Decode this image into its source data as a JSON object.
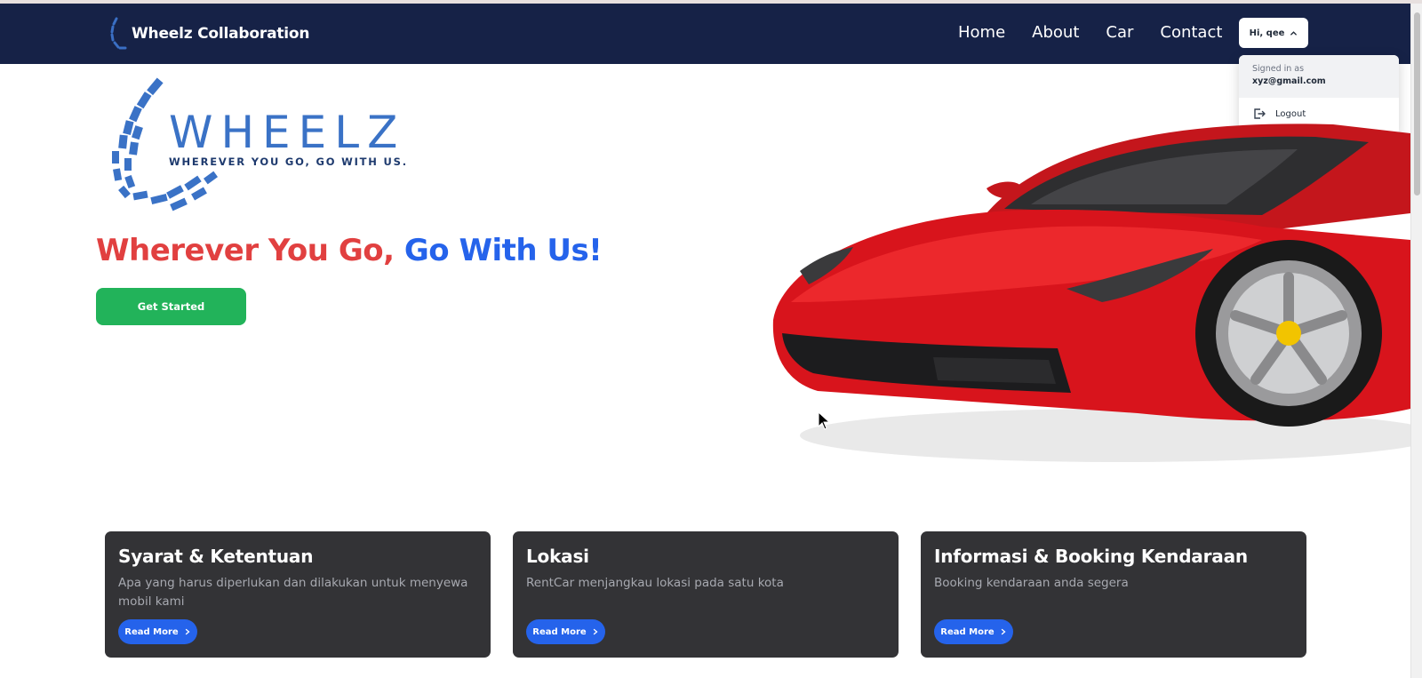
{
  "navbar": {
    "brand": "Wheelz Collaboration",
    "links": [
      "Home",
      "About",
      "Car",
      "Contact"
    ],
    "user_button": "Hi, qee"
  },
  "user_menu": {
    "signed_in_label": "Signed in as",
    "email": "xyz@gmail.com",
    "logout": "Logout"
  },
  "hero": {
    "logo_word": "WHEELZ",
    "logo_tagline": "WHEREVER YOU GO, GO WITH US.",
    "title_part1": "Wherever You Go,",
    "title_part2": "Go With Us!",
    "cta": "Get Started"
  },
  "cards": [
    {
      "title": "Syarat & Ketentuan",
      "text": "Apa yang harus diperlukan dan dilakukan untuk menyewa mobil kami",
      "button": "Read More"
    },
    {
      "title": "Lokasi",
      "text": "RentCar menjangkau lokasi pada satu kota",
      "button": "Read More"
    },
    {
      "title": "Informasi & Booking Kendaraan",
      "text": "Booking kendaraan anda segera",
      "button": "Read More"
    }
  ],
  "colors": {
    "navbar_bg": "#162247",
    "accent_blue": "#2563eb",
    "accent_red": "#e14040",
    "cta_green": "#22b35a",
    "card_bg": "#333336"
  }
}
